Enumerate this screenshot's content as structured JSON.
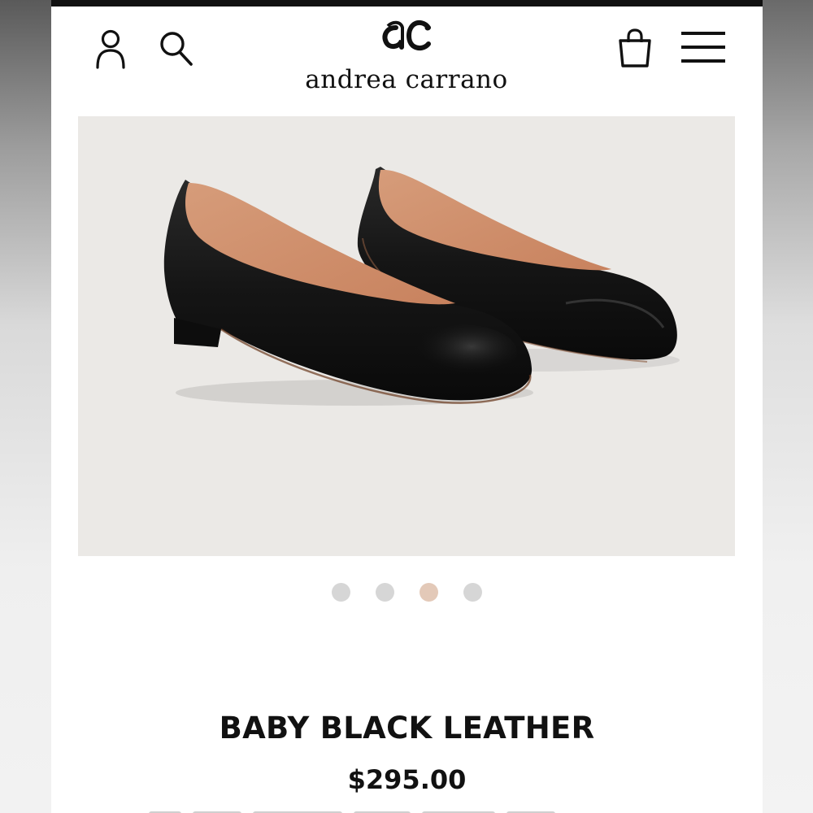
{
  "header": {
    "brand_monogram": "ac",
    "brand_name": "andrea carrano",
    "icons": [
      "account-icon",
      "search-icon",
      "shopping-bag-icon",
      "menu-icon"
    ]
  },
  "product": {
    "image_alt": "black leather ballet flats",
    "title": "BABY BLACK LEATHER",
    "price": "$295.00"
  },
  "carousel": {
    "count": 4,
    "active_index": 2,
    "dot_color": "#d6d6d6",
    "active_dot_color": "#e3c9b8"
  },
  "colors": {
    "image_background": "#ebe9e6",
    "text": "#111111",
    "top_bar": "#111111"
  }
}
